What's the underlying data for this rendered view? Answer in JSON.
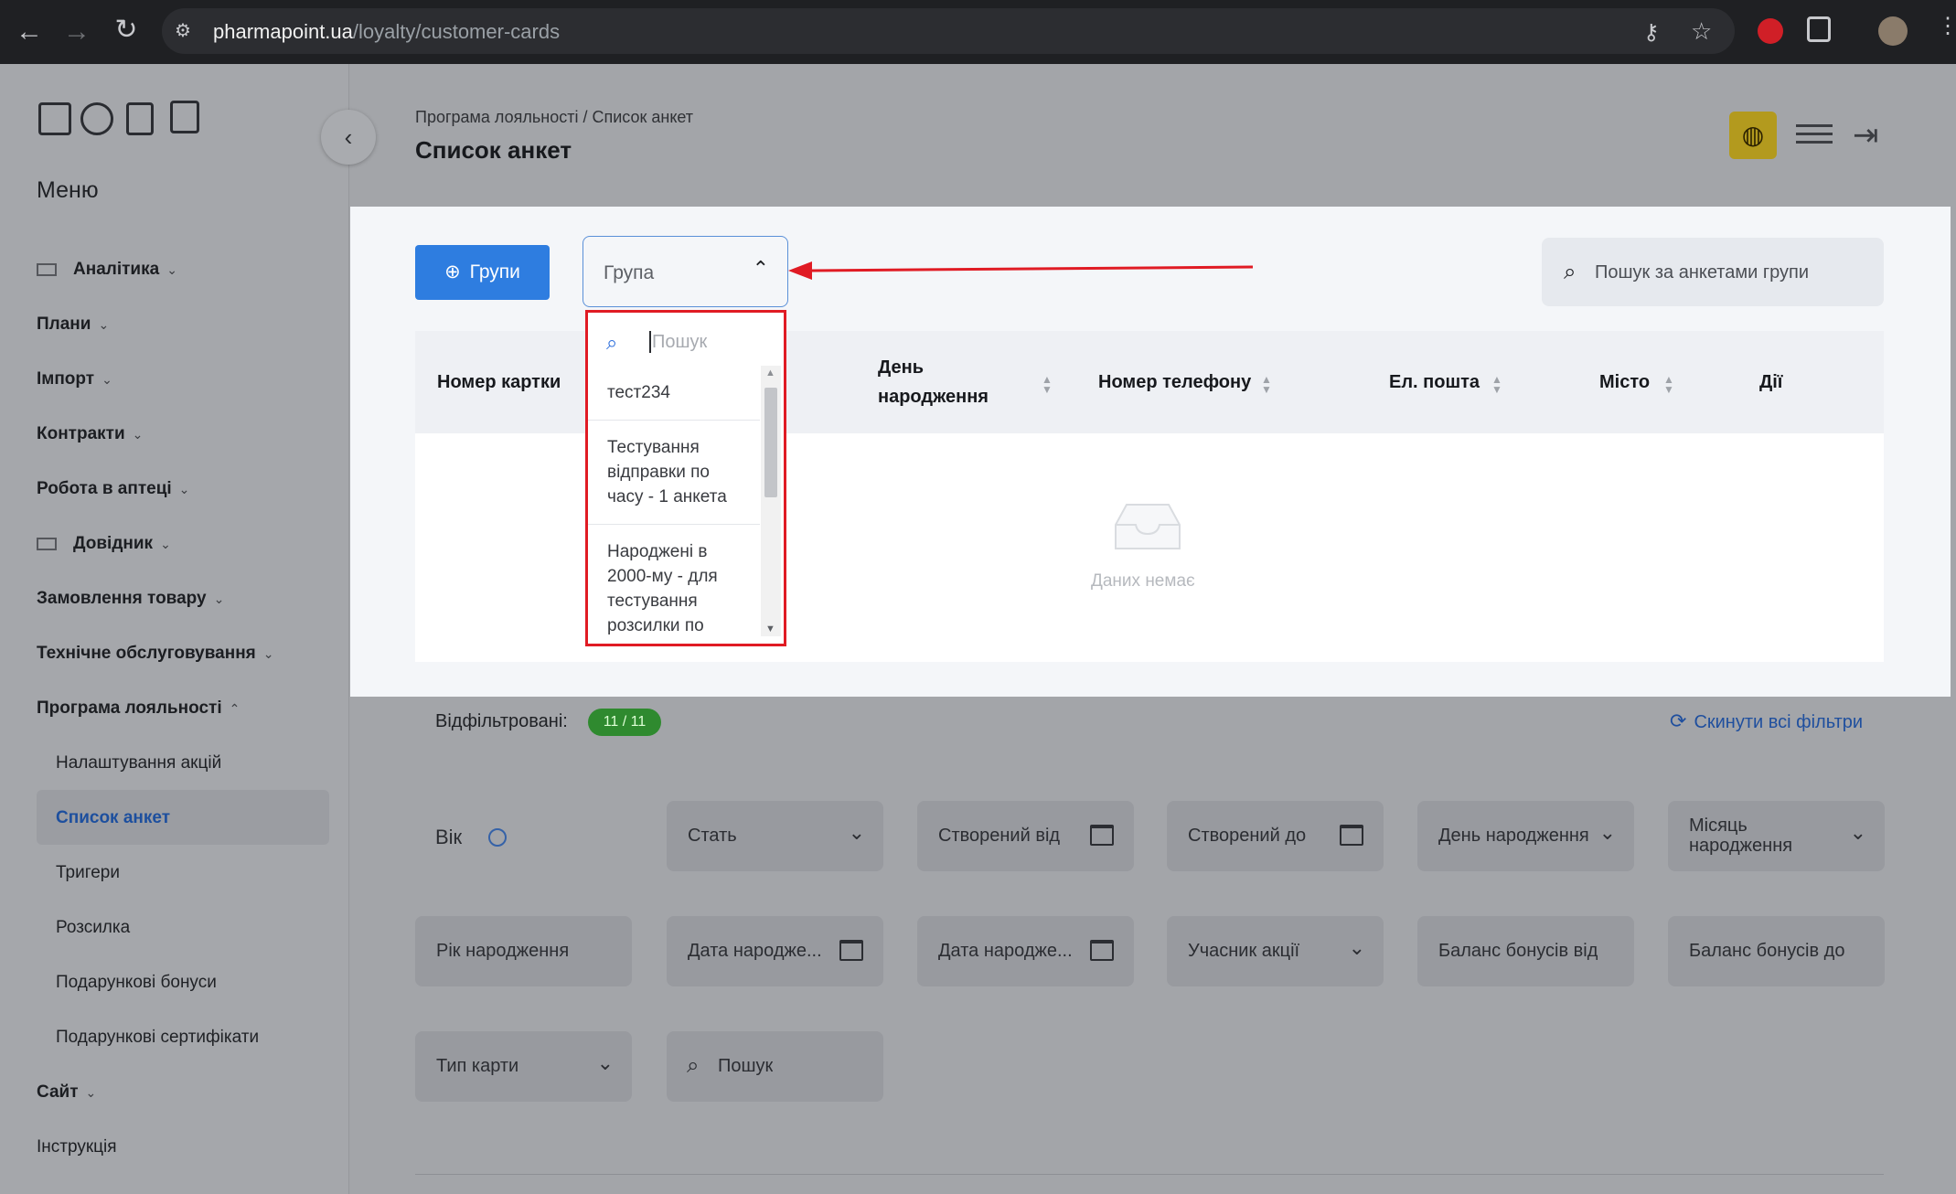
{
  "browser": {
    "url_domain": "pharmapoint.ua",
    "url_path": "/loyalty/customer-cards",
    "nav_icons": [
      "back-icon",
      "forward-icon",
      "reload-icon",
      "site-info-icon"
    ],
    "right_icons": [
      "key-icon",
      "star-icon",
      "extension-red-icon",
      "puzzle-icon",
      "avatar"
    ]
  },
  "sidebar": {
    "top_icons": [
      "box-icon",
      "pie-chart-icon",
      "document-icon",
      "book-icon"
    ],
    "menu_title": "Меню",
    "items": [
      {
        "label": "Аналітика",
        "chev": "⌄",
        "icon": "grid-icon"
      },
      {
        "label": "Плани",
        "chev": "⌄"
      },
      {
        "label": "Імпорт",
        "chev": "⌄"
      },
      {
        "label": "Контракти",
        "chev": "⌄"
      },
      {
        "label": "Робота в аптеці",
        "chev": "⌄"
      },
      {
        "label": "Довідник",
        "chev": "⌄",
        "icon": "list-icon"
      },
      {
        "label": "Замовлення товару",
        "chev": "⌄"
      },
      {
        "label": "Технічне обслуговування",
        "chev": "⌄"
      },
      {
        "label": "Програма лояльності",
        "chev": "⌃"
      },
      {
        "label": "Сайт",
        "chev": "⌄"
      },
      {
        "label": "Інструкція",
        "chev": ""
      }
    ],
    "subitems": [
      {
        "label": "Налаштування акцій"
      },
      {
        "label": "Список анкет",
        "active": true
      },
      {
        "label": "Тригери"
      },
      {
        "label": "Розсилка"
      },
      {
        "label": "Подарункові бонуси"
      },
      {
        "label": "Подарункові сертифікати"
      }
    ],
    "collapse_icon": "‹"
  },
  "header": {
    "breadcrumb": "Програма лояльності / Список анкет",
    "title": "Список анкет",
    "icons": [
      "globe-icon",
      "hamburger-icon",
      "logout-icon"
    ]
  },
  "toolbar": {
    "groups_button": "Групи",
    "group_select_placeholder": "Група",
    "search_placeholder": "Пошук за анкетами групи"
  },
  "dropdown": {
    "search_placeholder": "Пошук",
    "options": [
      "тест234",
      "Тестування відправки по часу - 1 анкета",
      "Народжені в 2000-му - для тестування розсилки по"
    ]
  },
  "table": {
    "columns": [
      "Номер картки",
      "День народження",
      "Номер телефону",
      "Ел. пошта",
      "Місто",
      "Дії"
    ],
    "empty_text": "Даних немає"
  },
  "filters": {
    "filtered_label": "Відфільтровані:",
    "filtered_badge": "11 / 11",
    "reset_label": "Скинути всі фільтри",
    "fields": {
      "age": "Вік",
      "sex": "Стать",
      "created_from": "Створений від",
      "created_to": "Створений до",
      "birth_day": "День народження",
      "birth_month": "Місяць народження",
      "birth_year": "Рік народження",
      "birth_date_from": "Дата народже...",
      "birth_date_to": "Дата народже...",
      "promo_member": "Учасник акції",
      "bonus_from": "Баланс бонусів від",
      "bonus_to": "Баланс бонусів до",
      "card_type": "Тип карти",
      "search": "Пошук"
    }
  },
  "colors": {
    "primary": "#2e7de0",
    "highlight_red": "#e01b24",
    "badge_green": "#2f8a2f",
    "globe_yellow": "#b39a1e"
  }
}
